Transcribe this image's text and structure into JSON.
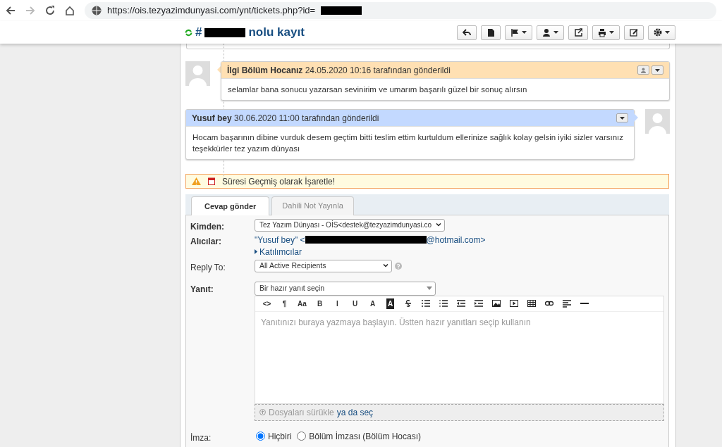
{
  "browser": {
    "url": "https://ois.tezyazimdunyasi.com/ynt/tickets.php?id="
  },
  "header": {
    "title_prefix": "#",
    "title_suffix": "nolu kayıt",
    "buttons": [
      {
        "kind": "reply",
        "caret": false
      },
      {
        "kind": "doc",
        "caret": false
      },
      {
        "kind": "flag",
        "caret": true
      },
      {
        "kind": "user",
        "caret": true
      },
      {
        "kind": "share",
        "caret": false
      },
      {
        "kind": "print",
        "caret": true
      },
      {
        "kind": "edit",
        "caret": false
      },
      {
        "kind": "gear",
        "caret": true
      }
    ]
  },
  "thread": [
    {
      "avatar_right": false,
      "color": "#ffe0b3",
      "author": "İlgi Bölüm Hocanız",
      "meta": "24.05.2020 10:16 tarafından gönderildi",
      "body": "selamlar bana sonucu yazarsan sevinirim ve umarım başarılı güzel bir sonuç alırsın",
      "user_button": true
    },
    {
      "avatar_right": true,
      "color": "#c3d9ff",
      "author": "Yusuf bey",
      "meta": "30.06.2020 11:00 tarafından gönderildi",
      "body": "Hocam başarının dibine vurduk desem geçtim bitti teslim ettim kurtuldum ellerinize sağlık kolay gelsin iyiki sizler varsınız teşekkürler tez yazım dünyası",
      "user_button": false
    }
  ],
  "warning": {
    "text": "Süresi Geçmiş olarak İşaretle!"
  },
  "tabs": [
    {
      "label": "Cevap gönder",
      "selected": true
    },
    {
      "label": "Dahili Not Yayınla",
      "selected": false
    }
  ],
  "form": {
    "from_label": "Kimden:",
    "from_value": "Tez Yazım Dünyası - OİS<destek@tezyazimdunyasi.co",
    "to_label": "Alıcılar:",
    "to_prefix": "\"Yusuf bey\" <",
    "to_suffix": "@hotmail.com>",
    "participants": "Katılımcılar",
    "replyto_label": "Reply To:",
    "replyto_value": "All Active Recipients",
    "response_label": "Yanıt:",
    "canned_value": "Bir hazır yanıt seçin",
    "toolbar": [
      {
        "kind": "text",
        "label": "<>"
      },
      {
        "kind": "text",
        "label": "¶"
      },
      {
        "kind": "text",
        "label": "Aa"
      },
      {
        "kind": "text",
        "label": "B"
      },
      {
        "kind": "text",
        "label": "I"
      },
      {
        "kind": "text",
        "label": "U"
      },
      {
        "kind": "text",
        "label": "A"
      },
      {
        "kind": "inverse",
        "label": "A"
      },
      {
        "kind": "strike"
      },
      {
        "kind": "ul"
      },
      {
        "kind": "ol"
      },
      {
        "kind": "outdent"
      },
      {
        "kind": "indent"
      },
      {
        "kind": "image"
      },
      {
        "kind": "video"
      },
      {
        "kind": "table"
      },
      {
        "kind": "link"
      },
      {
        "kind": "align"
      },
      {
        "kind": "hr"
      }
    ],
    "placeholder": "Yanıtınızı buraya yazmaya başlayın. Üstten hazır yanıtları seçip kullanın",
    "drop_text": "Dosyaları sürükle",
    "drop_link": "ya da seç",
    "signature_label": "İmza:",
    "signatures": [
      {
        "label": "Hiçbiri",
        "selected": true
      },
      {
        "label": "Bölüm İmzası (Bölüm Hocası)",
        "selected": false
      }
    ]
  }
}
